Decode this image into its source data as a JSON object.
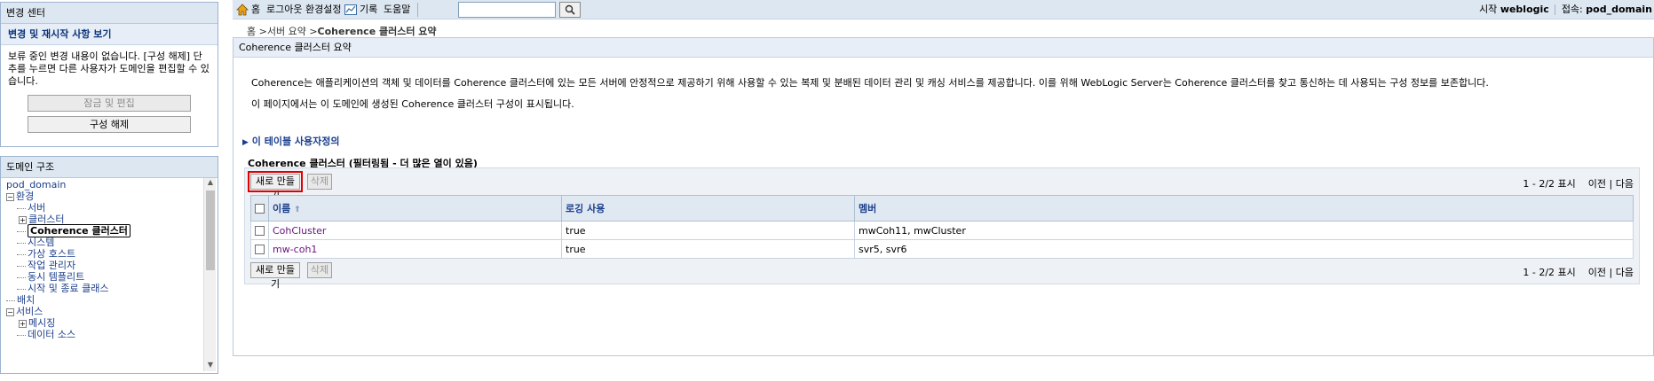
{
  "change_center": {
    "title": "변경 센터",
    "subtitle": "변경 및 재시작 사항 보기",
    "message": "보류 중인 변경 내용이 없습니다. [구성 해제] 단추를 누르면 다른 사용자가 도메인을 편집할 수 있습니다.",
    "lock_button": "잠금 및 편집",
    "release_button": "구성 해제"
  },
  "domain_structure": {
    "title": "도메인 구조",
    "root": "pod_domain",
    "items": [
      {
        "label": "환경",
        "expander": "−"
      },
      {
        "label": "서버"
      },
      {
        "label": "클러스터",
        "expander": "+"
      },
      {
        "label": "Coherence 클러스터",
        "selected": true
      },
      {
        "label": "시스템"
      },
      {
        "label": "가상 호스트"
      },
      {
        "label": "작업 관리자"
      },
      {
        "label": "동시 템플리트"
      },
      {
        "label": "시작 및 종료 클래스"
      },
      {
        "label": "배치"
      },
      {
        "label": "서비스",
        "expander": "−"
      },
      {
        "label": "메시징",
        "expander": "+"
      },
      {
        "label": "데이터 소스"
      }
    ]
  },
  "topbar": {
    "home": "홈",
    "logout": "로그아웃",
    "preferences": "환경설정",
    "record": "기록",
    "help": "도움말",
    "search_value": "",
    "welcome_label": "시작",
    "user": "weblogic",
    "connected_label": "접속:",
    "domain": "pod_domain"
  },
  "breadcrumb": {
    "home": "홈",
    "sep": " >",
    "item1": "서버 요약",
    "current": "Coherence 클러스터 요약"
  },
  "main": {
    "title": "Coherence 클러스터 요약",
    "desc1": "Coherence는 애플리케이션의 객체 및 데이터를 Coherence 클러스터에 있는 모든 서버에 안정적으로 제공하기 위해 사용할 수 있는 복제 및 분배된 데이터 관리 및 캐싱 서비스를 제공합니다. 이를 위해 WebLogic Server는 Coherence 클러스터를 찾고 통신하는 데 사용되는 구성 정보를 보존합니다.",
    "desc2": "이 페이지에서는 이 도메인에 생성된 Coherence 클러스터 구성이 표시됩니다.",
    "customize_link": "이 테이블 사용자정의",
    "table_title": "Coherence 클러스터 (필터링됨 - 더 많은 열이 있음)",
    "new_button": "새로 만들기",
    "delete_button": "삭제",
    "pager_count": "1 - 2/2 표시",
    "pager_prev": "이전",
    "pager_sep": "|",
    "pager_next": "다음",
    "columns": {
      "name": "이름",
      "logging": "로깅 사용",
      "members": "멤버"
    },
    "rows": [
      {
        "name": "CohCluster",
        "logging": "true",
        "members": "mwCoh11, mwCluster"
      },
      {
        "name": "mw-coh1",
        "logging": "true",
        "members": "svr5, svr6"
      }
    ]
  },
  "colors": {
    "header_bg": "#dde7f2",
    "link": "#1b3f8b",
    "visited_link": "#6b1580",
    "highlight": "#e00000"
  }
}
